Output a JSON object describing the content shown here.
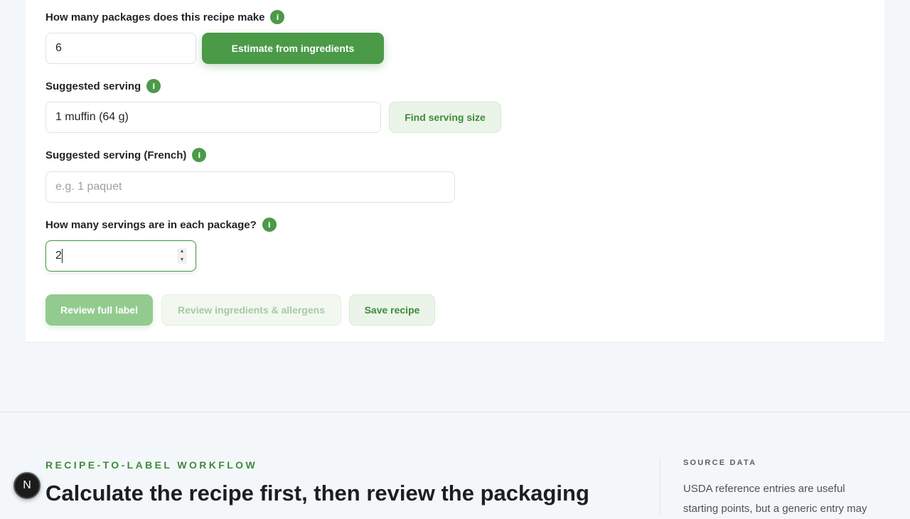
{
  "form": {
    "packages": {
      "label": "How many packages does this recipe make",
      "value": "6",
      "button": "Estimate from ingredients"
    },
    "serving": {
      "label": "Suggested serving",
      "value": "1 muffin (64 g)",
      "button": "Find serving size"
    },
    "serving_fr": {
      "label": "Suggested serving (French)",
      "placeholder": "e.g. 1 paquet"
    },
    "servings_per_package": {
      "label": "How many servings are in each package?",
      "value": "2"
    },
    "info_glyph": "i",
    "actions": {
      "review_label": "Review full label",
      "review_ingredients": "Review ingredients & allergens",
      "save": "Save recipe"
    }
  },
  "workflow": {
    "eyebrow": "RECIPE-TO-LABEL WORKFLOW",
    "headline": "Calculate the recipe first, then review the packaging"
  },
  "source": {
    "title": "SOURCE DATA",
    "text": "USDA reference entries are useful starting points, but a generic entry may"
  },
  "badge": {
    "letter": "N"
  },
  "colors": {
    "accent": "#4a9a48",
    "accent_soft": "#eaf4e8",
    "page_bg": "#f4f7f9"
  }
}
